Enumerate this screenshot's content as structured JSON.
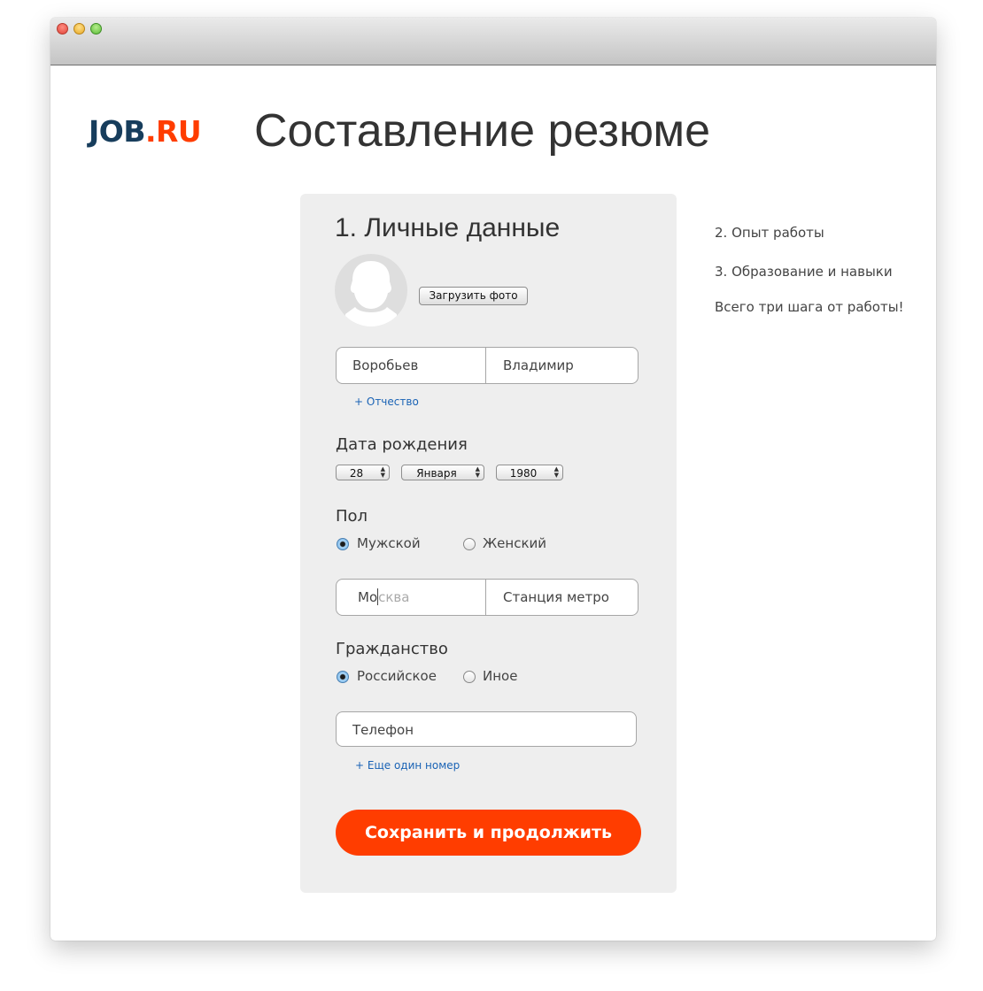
{
  "window": {
    "traffic_lights": [
      "close",
      "minimize",
      "zoom"
    ]
  },
  "logo": {
    "part1": "JOB",
    "part2": ".RU"
  },
  "page_title": "Составление резюме",
  "form": {
    "section_title": "1. Личные данные",
    "avatar_icon": "person-silhouette-icon",
    "upload_button": "Загрузить фото",
    "last_name": "Воробьев",
    "first_name": "Владимир",
    "add_patronymic": "+ Отчество",
    "birthdate": {
      "label": "Дата рождения",
      "day": "28",
      "month": "Января",
      "year": "1980"
    },
    "gender": {
      "label": "Пол",
      "options": [
        "Мужской",
        "Женский"
      ],
      "selected": "Мужской"
    },
    "city": {
      "typed": "Мо",
      "placeholder_rest": "сква"
    },
    "metro": {
      "placeholder": "Станция метро"
    },
    "citizenship": {
      "label": "Гражданство",
      "options": [
        "Российское",
        "Иное"
      ],
      "selected": "Российское"
    },
    "phone": {
      "placeholder": "Телефон"
    },
    "add_phone": "+ Еще один номер",
    "save_button": "Сохранить и продолжить"
  },
  "steps": {
    "step2": "2. Опыт работы",
    "step3": "3. Образование и навыки",
    "note": "Всего три шага от работы!"
  },
  "colors": {
    "brand_orange": "#ff3d00",
    "brand_navy": "#173d5c",
    "link_blue": "#1a63b5"
  }
}
